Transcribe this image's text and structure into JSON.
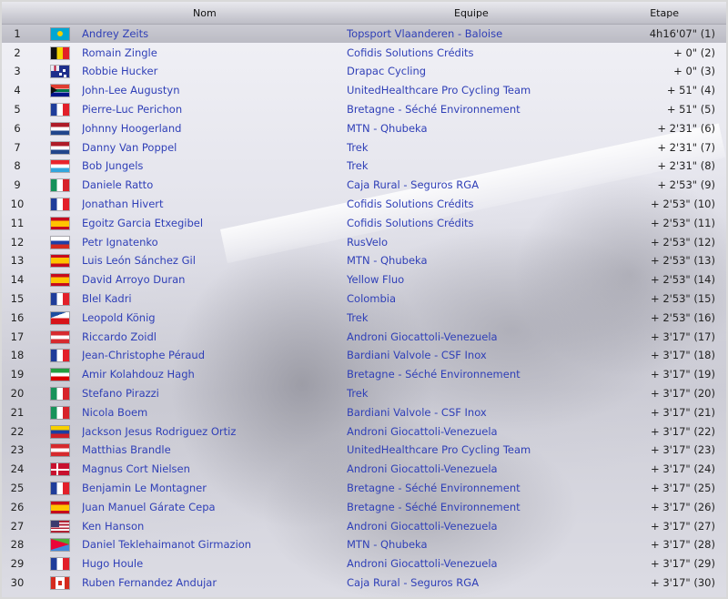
{
  "headers": {
    "nom": "Nom",
    "equipe": "Equipe",
    "etape": "Etape"
  },
  "rows": [
    {
      "rank": "1",
      "flag": "kz-flag-icon",
      "name": "Andrey Zeits",
      "team": "Topsport Vlaanderen - Baloise",
      "time": "4h16'07\" (1)"
    },
    {
      "rank": "2",
      "flag": "be-flag-icon",
      "name": "Romain Zingle",
      "team": "Cofidis Solutions Crédits",
      "time": "+ 0\" (2)"
    },
    {
      "rank": "3",
      "flag": "au-flag-icon",
      "name": "Robbie Hucker",
      "team": "Drapac Cycling",
      "time": "+ 0\" (3)"
    },
    {
      "rank": "4",
      "flag": "za-flag-icon",
      "name": "John-Lee Augustyn",
      "team": "UnitedHealthcare Pro Cycling Team",
      "time": "+ 51\" (4)"
    },
    {
      "rank": "5",
      "flag": "fr-flag-icon",
      "name": "Pierre-Luc Perichon",
      "team": "Bretagne - Séché Environnement",
      "time": "+ 51\" (5)"
    },
    {
      "rank": "6",
      "flag": "nl-flag-icon",
      "name": "Johnny Hoogerland",
      "team": "MTN - Qhubeka",
      "time": "+ 2'31\" (6)"
    },
    {
      "rank": "7",
      "flag": "nl-flag-icon",
      "name": "Danny Van Poppel",
      "team": "Trek",
      "time": "+ 2'31\" (7)"
    },
    {
      "rank": "8",
      "flag": "lu-flag-icon",
      "name": "Bob Jungels",
      "team": "Trek",
      "time": "+ 2'31\" (8)"
    },
    {
      "rank": "9",
      "flag": "it-flag-icon",
      "name": "Daniele Ratto",
      "team": "Caja Rural - Seguros RGA",
      "time": "+ 2'53\" (9)"
    },
    {
      "rank": "10",
      "flag": "fr-flag-icon",
      "name": "Jonathan Hivert",
      "team": "Cofidis Solutions Crédits",
      "time": "+ 2'53\" (10)"
    },
    {
      "rank": "11",
      "flag": "es-flag-icon",
      "name": "Egoitz Garcia Etxegibel",
      "team": "Cofidis Solutions Crédits",
      "time": "+ 2'53\" (11)"
    },
    {
      "rank": "12",
      "flag": "ru-flag-icon",
      "name": "Petr Ignatenko",
      "team": "RusVelo",
      "time": "+ 2'53\" (12)"
    },
    {
      "rank": "13",
      "flag": "es-flag-icon",
      "name": "Luis León Sánchez Gil",
      "team": "MTN - Qhubeka",
      "time": "+ 2'53\" (13)"
    },
    {
      "rank": "14",
      "flag": "es-flag-icon",
      "name": "David Arroyo Duran",
      "team": "Yellow Fluo",
      "time": "+ 2'53\" (14)"
    },
    {
      "rank": "15",
      "flag": "fr-flag-icon",
      "name": "Blel Kadri",
      "team": "Colombia",
      "time": "+ 2'53\" (15)"
    },
    {
      "rank": "16",
      "flag": "cz-flag-icon",
      "name": "Leopold König",
      "team": "Trek",
      "time": "+ 2'53\" (16)"
    },
    {
      "rank": "17",
      "flag": "at-flag-icon",
      "name": "Riccardo Zoidl",
      "team": "Androni Giocattoli-Venezuela",
      "time": "+ 3'17\" (17)"
    },
    {
      "rank": "18",
      "flag": "fr-flag-icon",
      "name": "Jean-Christophe Péraud",
      "team": "Bardiani Valvole - CSF Inox",
      "time": "+ 3'17\" (18)"
    },
    {
      "rank": "19",
      "flag": "ir-flag-icon",
      "name": "Amir Kolahdouz Hagh",
      "team": "Bretagne - Séché Environnement",
      "time": "+ 3'17\" (19)"
    },
    {
      "rank": "20",
      "flag": "it-flag-icon",
      "name": "Stefano Pirazzi",
      "team": "Trek",
      "time": "+ 3'17\" (20)"
    },
    {
      "rank": "21",
      "flag": "it-flag-icon",
      "name": "Nicola Boem",
      "team": "Bardiani Valvole - CSF Inox",
      "time": "+ 3'17\" (21)"
    },
    {
      "rank": "22",
      "flag": "ve-flag-icon",
      "name": "Jackson Jesus Rodriguez Ortiz",
      "team": "Androni Giocattoli-Venezuela",
      "time": "+ 3'17\" (22)"
    },
    {
      "rank": "23",
      "flag": "at-flag-icon",
      "name": "Matthias Brandle",
      "team": "UnitedHealthcare Pro Cycling Team",
      "time": "+ 3'17\" (23)"
    },
    {
      "rank": "24",
      "flag": "dk-flag-icon",
      "name": "Magnus Cort Nielsen",
      "team": "Androni Giocattoli-Venezuela",
      "time": "+ 3'17\" (24)"
    },
    {
      "rank": "25",
      "flag": "fr-flag-icon",
      "name": "Benjamin Le Montagner",
      "team": "Bretagne - Séché Environnement",
      "time": "+ 3'17\" (25)"
    },
    {
      "rank": "26",
      "flag": "es-flag-icon",
      "name": "Juan Manuel Gárate Cepa",
      "team": "Bretagne - Séché Environnement",
      "time": "+ 3'17\" (26)"
    },
    {
      "rank": "27",
      "flag": "us-flag-icon",
      "name": "Ken Hanson",
      "team": "Androni Giocattoli-Venezuela",
      "time": "+ 3'17\" (27)"
    },
    {
      "rank": "28",
      "flag": "er-flag-icon",
      "name": "Daniel Teklehaimanot Girmazion",
      "team": "MTN - Qhubeka",
      "time": "+ 3'17\" (28)"
    },
    {
      "rank": "29",
      "flag": "fr-flag-icon",
      "name": "Hugo Houle",
      "team": "Androni Giocattoli-Venezuela",
      "time": "+ 3'17\" (29)"
    },
    {
      "rank": "30",
      "flag": "ca-flag-icon",
      "name": "Ruben Fernandez Andujar",
      "team": "Caja Rural - Seguros RGA",
      "time": "+ 3'17\" (30)"
    }
  ]
}
